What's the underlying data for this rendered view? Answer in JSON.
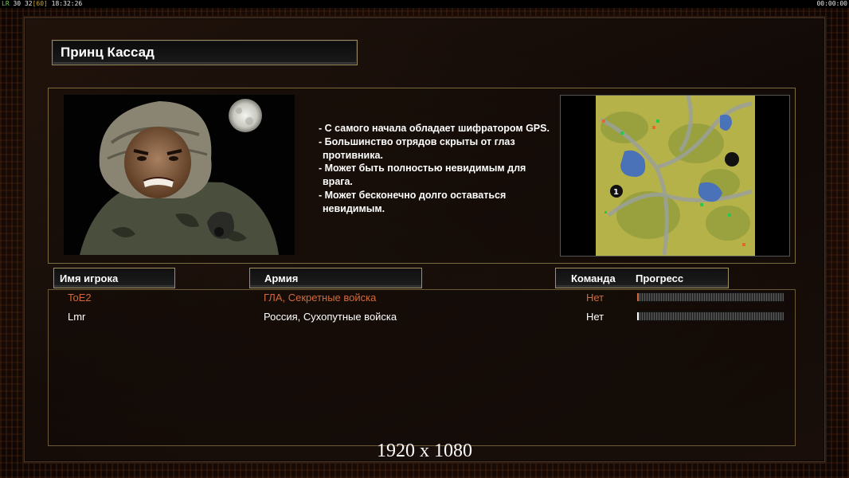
{
  "hud": {
    "fps_label": "LR",
    "fps_value": "30",
    "fps_max": "32",
    "fps_cap": "[60]",
    "clock": "18:32:26",
    "timer": "00:00:00"
  },
  "general": {
    "name": "Принц Кассад",
    "description": [
      "- С самого начала обладает шифратором GPS.",
      "- Большинство отрядов скрыты от глаз противника.",
      "- Может быть полностью невидимым для врага.",
      "- Может бесконечно долго оставаться невидимым."
    ]
  },
  "map": {
    "start_marker_1": "1"
  },
  "table": {
    "headers": {
      "player_name": "Имя игрока",
      "army": "Армия",
      "team": "Команда",
      "progress": "Прогресс"
    },
    "rows": [
      {
        "name": "ToE2",
        "army": "ГЛА, Секретные войска",
        "team": "Нет",
        "progress": 0.01,
        "color": "#d2693a"
      },
      {
        "name": "Lmr",
        "army": "Россия, Сухопутные войска",
        "team": "Нет",
        "progress": 0.01,
        "color": "#ffffff"
      }
    ]
  },
  "resolution_label": "1920 x 1080",
  "colors": {
    "accent_gold": "#9a8a60",
    "player1": "#d2693a",
    "player2": "#ffffff"
  }
}
